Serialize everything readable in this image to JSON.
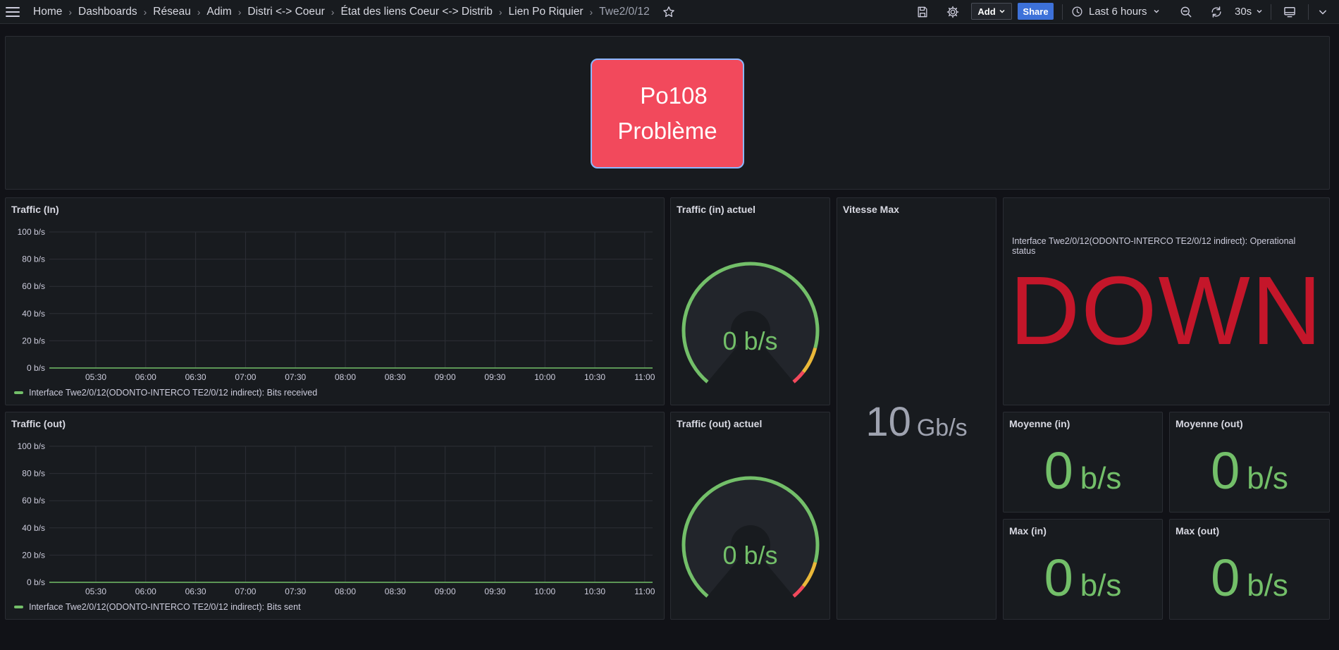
{
  "nav": {
    "breadcrumbs": [
      "Home",
      "Dashboards",
      "Réseau",
      "Adim",
      "Distri <-> Coeur",
      "État des liens Coeur <-> Distrib",
      "Lien Po Riquier",
      "Twe2/0/12"
    ],
    "add_label": "Add",
    "share_label": "Share",
    "time_range": "Last 6 hours",
    "refresh_interval": "30s",
    "icons": [
      "menu-icon",
      "star-icon",
      "save-icon",
      "gear-icon",
      "clock-icon",
      "chevron-down-icon",
      "zoom-out-icon",
      "refresh-icon",
      "tv-icon"
    ]
  },
  "status": {
    "line1": "Po108",
    "line2": "Problème",
    "color": "#f2495c"
  },
  "traffic_in": {
    "title": "Traffic (In)",
    "legend": "Interface Twe2/0/12(ODONTO-INTERCO TE2/0/12 indirect): Bits received"
  },
  "traffic_out": {
    "title": "Traffic (out)",
    "legend": "Interface Twe2/0/12(ODONTO-INTERCO TE2/0/12 indirect): Bits sent"
  },
  "gauge_in": {
    "title": "Traffic (in) actuel",
    "value": "0 b/s",
    "fraction": 0
  },
  "gauge_out": {
    "title": "Traffic (out) actuel",
    "value": "0 b/s",
    "fraction": 0
  },
  "vitesse_max": {
    "title": "Vitesse Max",
    "value": "10",
    "unit": "Gb/s"
  },
  "oper_status": {
    "description": "Interface Twe2/0/12(ODONTO-INTERCO TE2/0/12 indirect): Operational status",
    "value": "DOWN",
    "color": "#c4162a"
  },
  "stats": {
    "moy_in": {
      "title": "Moyenne (in)",
      "value": "0",
      "unit": "b/s"
    },
    "moy_out": {
      "title": "Moyenne (out)",
      "value": "0",
      "unit": "b/s"
    },
    "max_in": {
      "title": "Max (in)",
      "value": "0",
      "unit": "b/s"
    },
    "max_out": {
      "title": "Max (out)",
      "value": "0",
      "unit": "b/s"
    }
  },
  "chart_data": [
    {
      "type": "line",
      "y_ticks": [
        "100 b/s",
        "80 b/s",
        "60 b/s",
        "40 b/s",
        "20 b/s",
        "0 b/s"
      ],
      "x_ticks": [
        "05:30",
        "06:00",
        "06:30",
        "07:00",
        "07:30",
        "08:00",
        "08:30",
        "09:00",
        "09:30",
        "10:00",
        "10:30",
        "11:00"
      ],
      "ylim": [
        0,
        100
      ],
      "grid": true,
      "legend_position": "bottom-left",
      "series": [
        {
          "name": "Interface Twe2/0/12(ODONTO-INTERCO TE2/0/12 indirect): Bits received",
          "color": "#73bf69",
          "x": [
            "05:30",
            "11:00"
          ],
          "y": [
            0,
            0
          ]
        }
      ]
    },
    {
      "type": "line",
      "y_ticks": [
        "100 b/s",
        "80 b/s",
        "60 b/s",
        "40 b/s",
        "20 b/s",
        "0 b/s"
      ],
      "x_ticks": [
        "05:30",
        "06:00",
        "06:30",
        "07:00",
        "07:30",
        "08:00",
        "08:30",
        "09:00",
        "09:30",
        "10:00",
        "10:30",
        "11:00"
      ],
      "ylim": [
        0,
        100
      ],
      "grid": true,
      "legend_position": "bottom-left",
      "series": [
        {
          "name": "Interface Twe2/0/12(ODONTO-INTERCO TE2/0/12 indirect): Bits sent",
          "color": "#73bf69",
          "x": [
            "05:30",
            "11:00"
          ],
          "y": [
            0,
            0
          ]
        }
      ]
    }
  ]
}
